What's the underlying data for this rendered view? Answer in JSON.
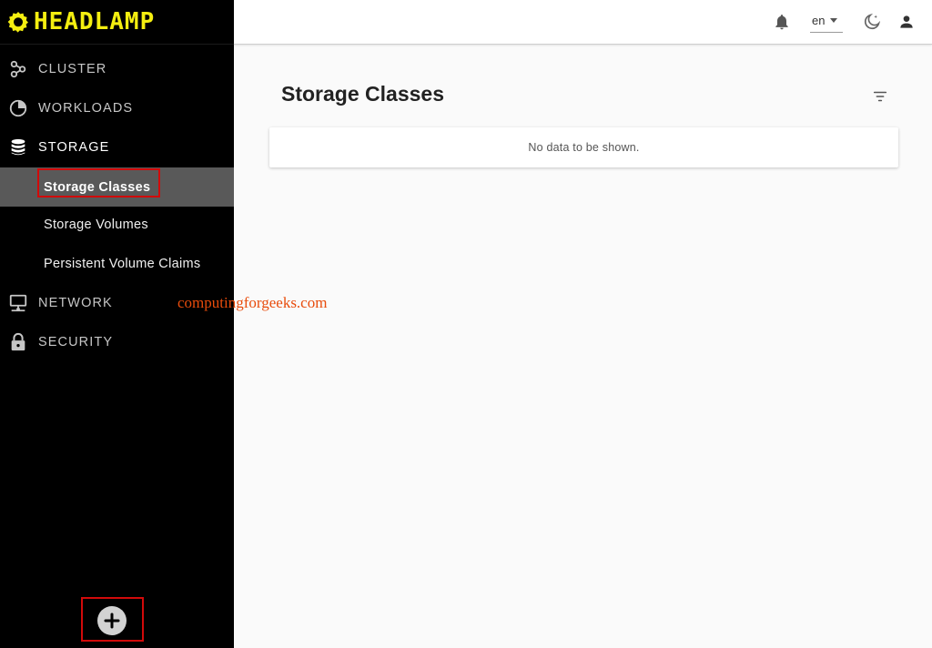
{
  "app": {
    "name": "HEADLAMP"
  },
  "sidebar": {
    "items": [
      {
        "label": "CLUSTER",
        "icon": "cluster-icon"
      },
      {
        "label": "WORKLOADS",
        "icon": "workloads-icon"
      },
      {
        "label": "STORAGE",
        "icon": "storage-icon",
        "active": true,
        "children": [
          {
            "label": "Storage Classes",
            "selected": true
          },
          {
            "label": "Storage Volumes"
          },
          {
            "label": "Persistent Volume Claims"
          }
        ]
      },
      {
        "label": "NETWORK",
        "icon": "network-icon"
      },
      {
        "label": "SECURITY",
        "icon": "lock-icon"
      }
    ],
    "add_button_icon": "plus-icon"
  },
  "topbar": {
    "notifications_icon": "bell-icon",
    "language": {
      "value": "en"
    },
    "theme_icon": "moon-icon",
    "user_icon": "person-icon"
  },
  "main": {
    "title": "Storage Classes",
    "filter_icon": "filter-icon",
    "table": {
      "empty_message": "No data to be shown."
    }
  },
  "watermark": {
    "text": "computingforgeeks.com"
  },
  "colors": {
    "sidebar_bg": "#000000",
    "logo_yellow": "#f4ee10",
    "selected_bg": "#595959",
    "highlight_border": "#d20a0a",
    "watermark": "#e84c0c",
    "content_bg": "#fafafa"
  }
}
